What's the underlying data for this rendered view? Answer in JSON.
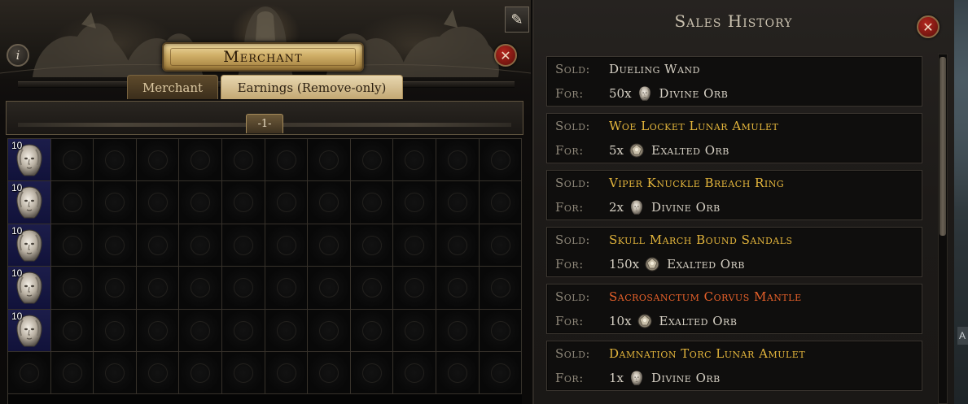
{
  "merchant": {
    "title": "Merchant",
    "info_icon": "info-icon",
    "close_icon": "close-icon",
    "edit_icon": "quill-edit-icon",
    "tabs": [
      {
        "label": "Merchant",
        "active": false
      },
      {
        "label": "Earnings (Remove-only)",
        "active": true
      }
    ],
    "page_tab": "-1-",
    "grid": {
      "columns": 12,
      "rows": 6,
      "items": [
        {
          "row": 0,
          "col": 0,
          "name": "Divine Orb",
          "icon": "divine-orb-icon",
          "stack": "10"
        },
        {
          "row": 1,
          "col": 0,
          "name": "Divine Orb",
          "icon": "divine-orb-icon",
          "stack": "10"
        },
        {
          "row": 2,
          "col": 0,
          "name": "Divine Orb",
          "icon": "divine-orb-icon",
          "stack": "10"
        },
        {
          "row": 3,
          "col": 0,
          "name": "Divine Orb",
          "icon": "divine-orb-icon",
          "stack": "10"
        },
        {
          "row": 4,
          "col": 0,
          "name": "Divine Orb",
          "icon": "divine-orb-icon",
          "stack": "10"
        }
      ]
    }
  },
  "sales_history": {
    "title": "Sales History",
    "close_icon": "close-icon",
    "sold_label": "Sold:",
    "for_label": "For:",
    "entries": [
      {
        "item": "Dueling Wand",
        "rarity": "normal",
        "qty": "50x",
        "currency": "Divine Orb",
        "currency_icon": "divine-orb-icon"
      },
      {
        "item": "Woe Locket Lunar Amulet",
        "rarity": "rare",
        "qty": "5x",
        "currency": "Exalted Orb",
        "currency_icon": "exalted-orb-icon"
      },
      {
        "item": "Viper Knuckle Breach Ring",
        "rarity": "rare",
        "qty": "2x",
        "currency": "Divine Orb",
        "currency_icon": "divine-orb-icon"
      },
      {
        "item": "Skull March Bound Sandals",
        "rarity": "rare",
        "qty": "150x",
        "currency": "Exalted Orb",
        "currency_icon": "exalted-orb-icon"
      },
      {
        "item": "Sacrosanctum Corvus Mantle",
        "rarity": "relic",
        "qty": "10x",
        "currency": "Exalted Orb",
        "currency_icon": "exalted-orb-icon"
      },
      {
        "item": "Damnation Torc Lunar Amulet",
        "rarity": "rare",
        "qty": "1x",
        "currency": "Divine Orb",
        "currency_icon": "divine-orb-icon"
      }
    ]
  },
  "edge_label": "A",
  "colors": {
    "rare_text": "#e3b53c",
    "relic_text": "#e8612a",
    "normal_text": "#d6d0c4",
    "label_text": "#8e8779",
    "close_red": "#b3261e",
    "gold_plate": "#cfae66"
  }
}
